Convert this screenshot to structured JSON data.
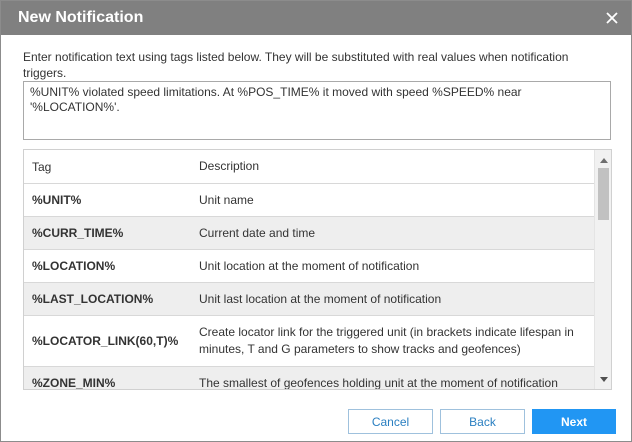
{
  "dialog": {
    "title": "New Notification",
    "close_icon": "close-icon"
  },
  "instructions": "Enter notification text using tags listed below. They will be substituted with real values when notification triggers.",
  "message_text": "%UNIT% violated speed limitations. At %POS_TIME% it moved with speed %SPEED% near '%LOCATION%'.",
  "table": {
    "headers": {
      "tag": "Tag",
      "description": "Description"
    },
    "rows": [
      {
        "tag": "%UNIT%",
        "description": "Unit name"
      },
      {
        "tag": "%CURR_TIME%",
        "description": "Current date and time"
      },
      {
        "tag": "%LOCATION%",
        "description": "Unit location at the moment of notification"
      },
      {
        "tag": "%LAST_LOCATION%",
        "description": "Unit last location at the moment of notification"
      },
      {
        "tag": "%LOCATOR_LINK(60,T)%",
        "description": "Create locator link for the triggered unit (in brackets indicate lifespan in minutes, T and G parameters to show tracks and geofences)"
      },
      {
        "tag": "%ZONE_MIN%",
        "description": "The smallest of geofences holding unit at the moment of notification"
      }
    ]
  },
  "buttons": {
    "cancel": "Cancel",
    "back": "Back",
    "next": "Next"
  },
  "colors": {
    "titlebar": "#808080",
    "primary": "#2196f3",
    "secondary_text": "#2a7fc1"
  }
}
